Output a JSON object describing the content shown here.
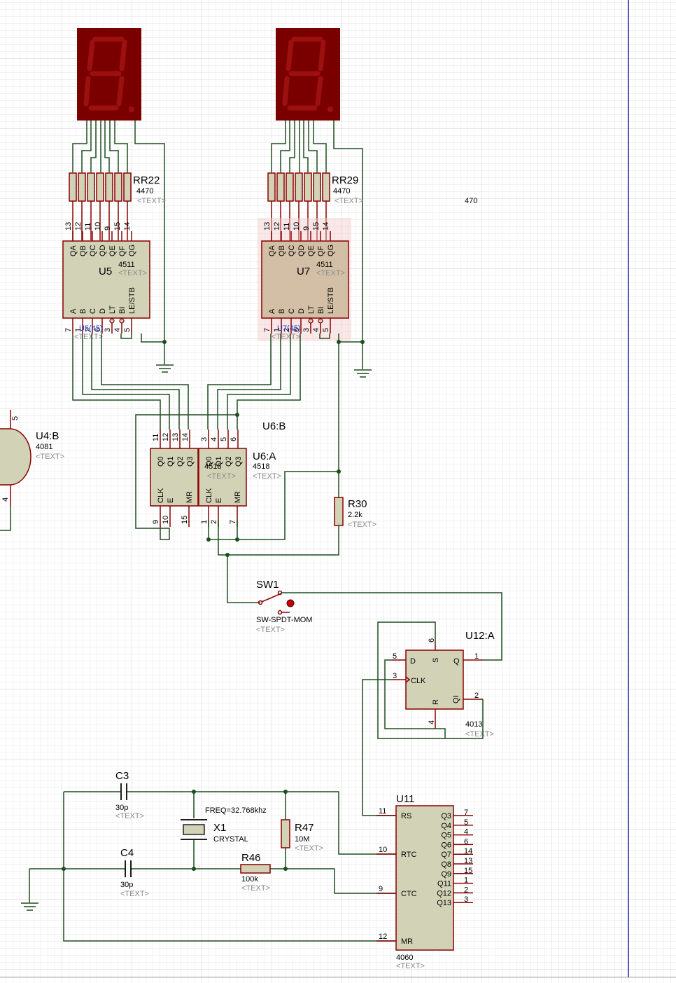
{
  "colors": {
    "wire": "#1e4d1e",
    "pin": "#8a0000",
    "chip_fill": "#d2d2b6",
    "chip_selected_fill": "#d3bfa6",
    "display_body": "#7a0000",
    "segment_off": "#9c1010",
    "grid": "#dcdcdc",
    "margin_line": "#2020a0",
    "placeholder": "#8a8a8a"
  },
  "displays": [
    {
      "name": "display-left"
    },
    {
      "name": "display-right"
    }
  ],
  "resistor_packs": [
    {
      "ref_overlap": "RR22",
      "value": "470",
      "value_overlap": "4470",
      "text_overlap": "<TEXT>"
    },
    {
      "ref_overlap": "RR29",
      "value": "470",
      "value_overlap": "4470",
      "text_overlap": "<TEXT>"
    }
  ],
  "stray_value": "470",
  "decoders": [
    {
      "ref": "U5",
      "part": "4511",
      "text": "<TEXT>",
      "top_pins": [
        "QA",
        "QB",
        "QC",
        "QD",
        "QE",
        "QF",
        "QG"
      ],
      "top_nums": [
        "13",
        "12",
        "11",
        "10",
        "9",
        "15",
        "14"
      ],
      "bottom_pins": [
        "A",
        "B",
        "C",
        "D",
        "LT",
        "BI",
        "LE/STB"
      ],
      "bottom_nums": [
        "7",
        "1",
        "2",
        "6",
        "3",
        "4",
        "5"
      ],
      "overlap_ref": "U5(45)",
      "overlap_text": "<TEXT>"
    },
    {
      "ref": "U7",
      "part": "4511",
      "text": "<TEXT>",
      "top_pins": [
        "QA",
        "QB",
        "QC",
        "QD",
        "QE",
        "QF",
        "QG"
      ],
      "top_nums": [
        "13",
        "12",
        "11",
        "10",
        "9",
        "15",
        "14"
      ],
      "bottom_pins": [
        "A",
        "B",
        "C",
        "D",
        "LT",
        "BI",
        "LE/STB"
      ],
      "bottom_nums": [
        "7",
        "1",
        "2",
        "6",
        "3",
        "4",
        "5"
      ],
      "overlap_ref": "U7(45)",
      "overlap_text": "<TEXT>"
    }
  ],
  "counter_b": {
    "ref": "U6:B",
    "top_pins": [
      "Q0",
      "Q1",
      "Q2",
      "Q3"
    ],
    "top_nums": [
      "11",
      "12",
      "13",
      "14"
    ],
    "bottom_pins": [
      "CLK",
      "E",
      "MR"
    ],
    "bottom_nums": [
      "9",
      "10",
      "15"
    ]
  },
  "counter_a": {
    "ref": "U6:A",
    "part": "4518",
    "part_inner": "4518",
    "text": "<TEXT>",
    "text_inner": "<TEXT>",
    "top_pins": [
      "Q0",
      "Q1",
      "Q2",
      "Q3"
    ],
    "top_nums": [
      "3",
      "4",
      "5",
      "6"
    ],
    "bottom_pins": [
      "CLK",
      "E",
      "MR"
    ],
    "bottom_nums": [
      "1",
      "2",
      "7"
    ]
  },
  "and_gate": {
    "ref": "U4:B",
    "part": "4081",
    "text": "<TEXT>",
    "pin_top": "5",
    "pin_bottom": "4"
  },
  "r30": {
    "ref": "R30",
    "value": "2.2k",
    "text": "<TEXT>"
  },
  "switch": {
    "ref": "SW1",
    "part": "SW-SPDT-MOM",
    "text": "<TEXT>"
  },
  "flipflop": {
    "ref": "U12:A",
    "part": "4013",
    "text": "<TEXT>",
    "pins": {
      "D": "D",
      "S": "S",
      "Q": "Q",
      "CLK": "CLK",
      "R": "R",
      "QI": "QI"
    },
    "nums": {
      "D": "5",
      "S": "6",
      "Q": "1",
      "CLK": "3",
      "R": "4",
      "QI": "2"
    }
  },
  "c3": {
    "ref": "C3",
    "value": "30p",
    "text": "<TEXT>"
  },
  "c4": {
    "ref": "C4",
    "value": "30p",
    "text": "<TEXT>"
  },
  "x1": {
    "ref": "X1",
    "part": "CRYSTAL",
    "freq": "FREQ=32.768khz"
  },
  "r47": {
    "ref": "R47",
    "value": "10M",
    "text": "<TEXT>"
  },
  "r46": {
    "ref": "R46",
    "value": "100k",
    "text": "<TEXT>"
  },
  "u11": {
    "ref": "U11",
    "part": "4060",
    "text": "<TEXT>",
    "left_pins": [
      {
        "label": "RS",
        "num": "11"
      },
      {
        "label": "RTC",
        "num": "10"
      },
      {
        "label": "CTC",
        "num": "9"
      },
      {
        "label": "MR",
        "num": "12"
      }
    ],
    "right_pins": [
      {
        "label": "Q3",
        "num": "7"
      },
      {
        "label": "Q4",
        "num": "5"
      },
      {
        "label": "Q5",
        "num": "4"
      },
      {
        "label": "Q6",
        "num": "6"
      },
      {
        "label": "Q7",
        "num": "14"
      },
      {
        "label": "Q8",
        "num": "13"
      },
      {
        "label": "Q9",
        "num": "15"
      },
      {
        "label": "Q11",
        "num": "1"
      },
      {
        "label": "Q12",
        "num": "2"
      },
      {
        "label": "Q13",
        "num": "3"
      }
    ]
  }
}
